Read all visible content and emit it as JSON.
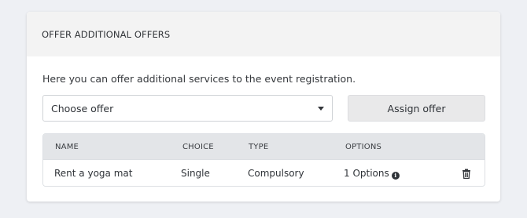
{
  "card": {
    "title": "OFFER ADDITIONAL OFFERS",
    "intro": "Here you can offer additional services to the event registration."
  },
  "offer_select": {
    "selected": "Choose offer"
  },
  "assign_button": {
    "label": "Assign offer"
  },
  "table": {
    "columns": [
      "NAME",
      "CHOICE",
      "TYPE",
      "OPTIONS"
    ],
    "rows": [
      {
        "name": "Rent a yoga mat",
        "choice": "Single",
        "type": "Compulsory",
        "options": "1 Options"
      }
    ]
  },
  "icons": {
    "options_info": "info-icon",
    "delete": "trash-icon"
  }
}
